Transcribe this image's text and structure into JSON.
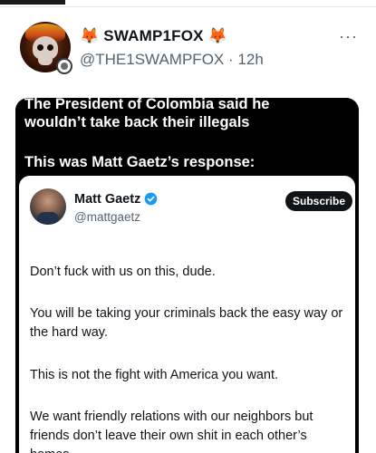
{
  "post": {
    "display_name": "🦊 SWAMP1FOX 🦊",
    "handle": "@THE1SWAMPFOX",
    "time": "12h",
    "more_icon": "more-horizontal-icon"
  },
  "media": {
    "caption_lines": [
      "The President of Colombia said he",
      "wouldn’t take back their illegals",
      "This was Matt Gaetz’s response:"
    ],
    "embedded_post": {
      "name": "Matt Gaetz",
      "handle": "@mattgaetz",
      "verified_icon": "verified-badge-icon",
      "subscribe_label": "Subscribe",
      "paragraphs": [
        "Don’t fuck with us on this, dude.",
        "You will be taking your criminals back the easy way or the hard way.",
        "This is not the fight with America you want.",
        "We want friendly relations with our neighbors but friends don’t leave their own shit in each other’s homes."
      ]
    }
  },
  "colors": {
    "text": "#0f1419",
    "secondary_text": "#536471",
    "verified_blue": "#1d9bf0",
    "subscribe_bg": "#0f1419"
  }
}
